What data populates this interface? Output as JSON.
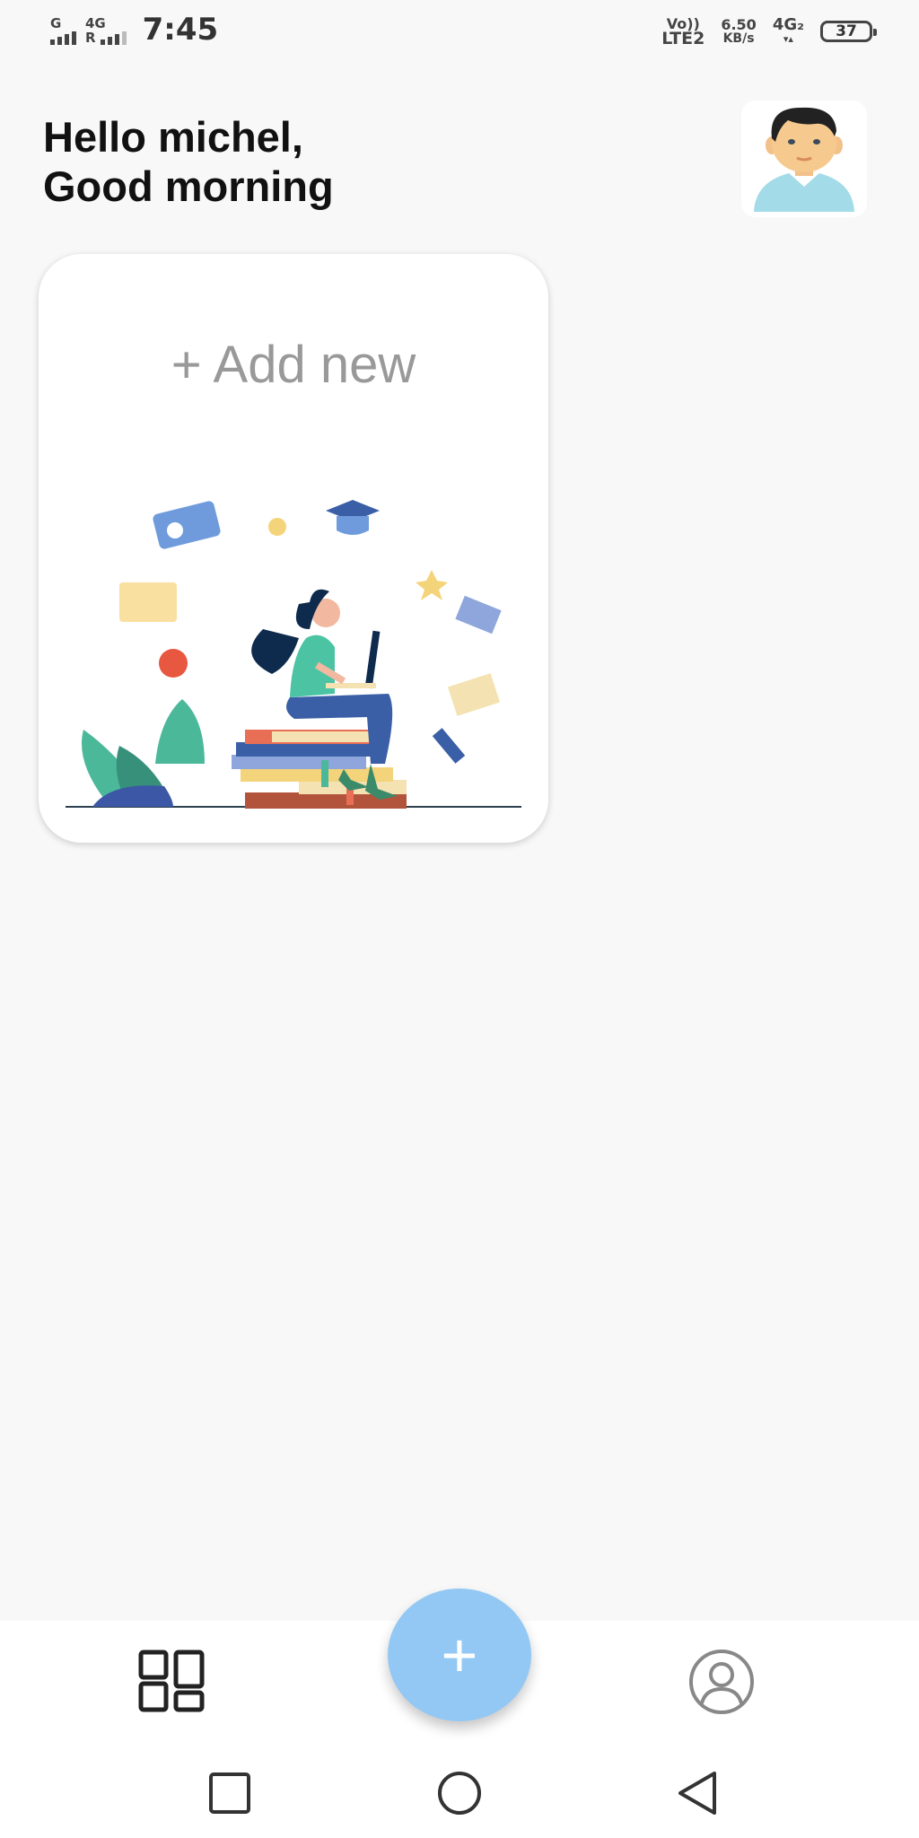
{
  "status_bar": {
    "sim1_label": "G",
    "sim2_label": "4G",
    "sim2_sub": "R",
    "time": "7:45",
    "volte_top": "Vo))",
    "volte_bottom": "LTE2",
    "speed_value": "6.50",
    "speed_unit": "KB/s",
    "network2": "4G₂",
    "network2_arrows": "▾▴",
    "battery_level": "37"
  },
  "header": {
    "greeting_line1": "Hello michel,",
    "greeting_line2": "Good morning"
  },
  "card": {
    "add_new_label": "+ Add new"
  },
  "fab": {
    "label": "+"
  },
  "bottom_nav": {
    "items": [
      {
        "icon": "dashboard-icon"
      },
      {
        "icon": "profile-icon"
      }
    ]
  },
  "system_nav": {
    "buttons": [
      "recent-apps-icon",
      "home-icon",
      "back-icon"
    ]
  },
  "colors": {
    "fab": "#93c8f4",
    "background": "#f8f8f8",
    "card": "#ffffff"
  }
}
